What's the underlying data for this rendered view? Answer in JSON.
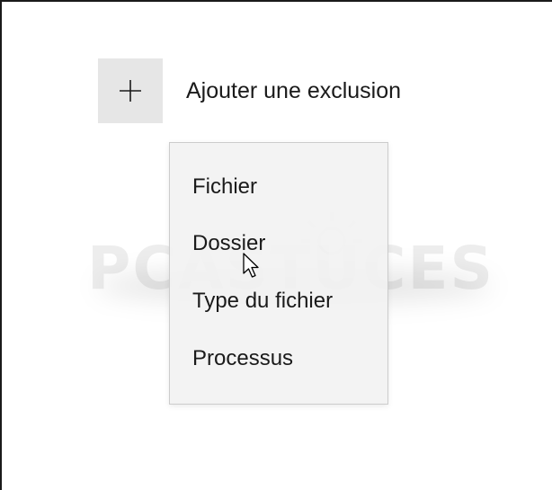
{
  "add_exclusion": {
    "icon": "plus-icon",
    "label": "Ajouter une exclusion"
  },
  "menu": {
    "items": [
      {
        "label": "Fichier"
      },
      {
        "label": "Dossier"
      },
      {
        "label": "Type du fichier"
      },
      {
        "label": "Processus"
      }
    ],
    "hovered": "Dossier"
  },
  "watermark": {
    "text": "PCASTUCES"
  },
  "colors": {
    "button_bg": "#e6e6e6",
    "menu_bg": "#f2f2f2",
    "text": "#1a1a1a"
  }
}
